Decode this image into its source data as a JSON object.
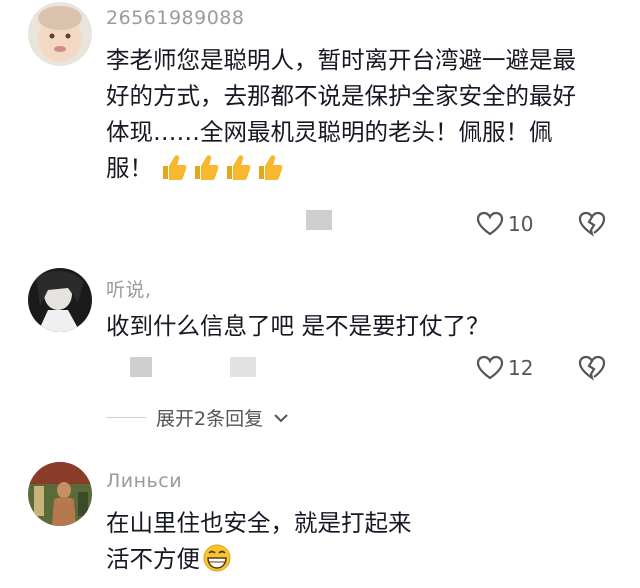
{
  "comments": [
    {
      "username": "26561989088",
      "text": "李老师您是聪明人，暂时离开台湾避一避是最好的方式，去那都不说是保护全家安全的最好体现……全网最机灵聪明的老头！佩服！佩服！",
      "emoji": "thumbs-up-icon",
      "likes": "10"
    },
    {
      "username": "听说,",
      "text": "收到什么信息了吧 是不是要打仗了？",
      "likes": "12"
    },
    {
      "username": "Линьси",
      "text_line1": "在山里住也安全，就是打起来",
      "text_line2": "活不方便",
      "emoji": "grinning-face-icon"
    }
  ],
  "replies_label": "展开2条回复",
  "colors": {
    "username": "#9a9aa0",
    "text": "#161823",
    "thumb": "#f5b82e"
  }
}
